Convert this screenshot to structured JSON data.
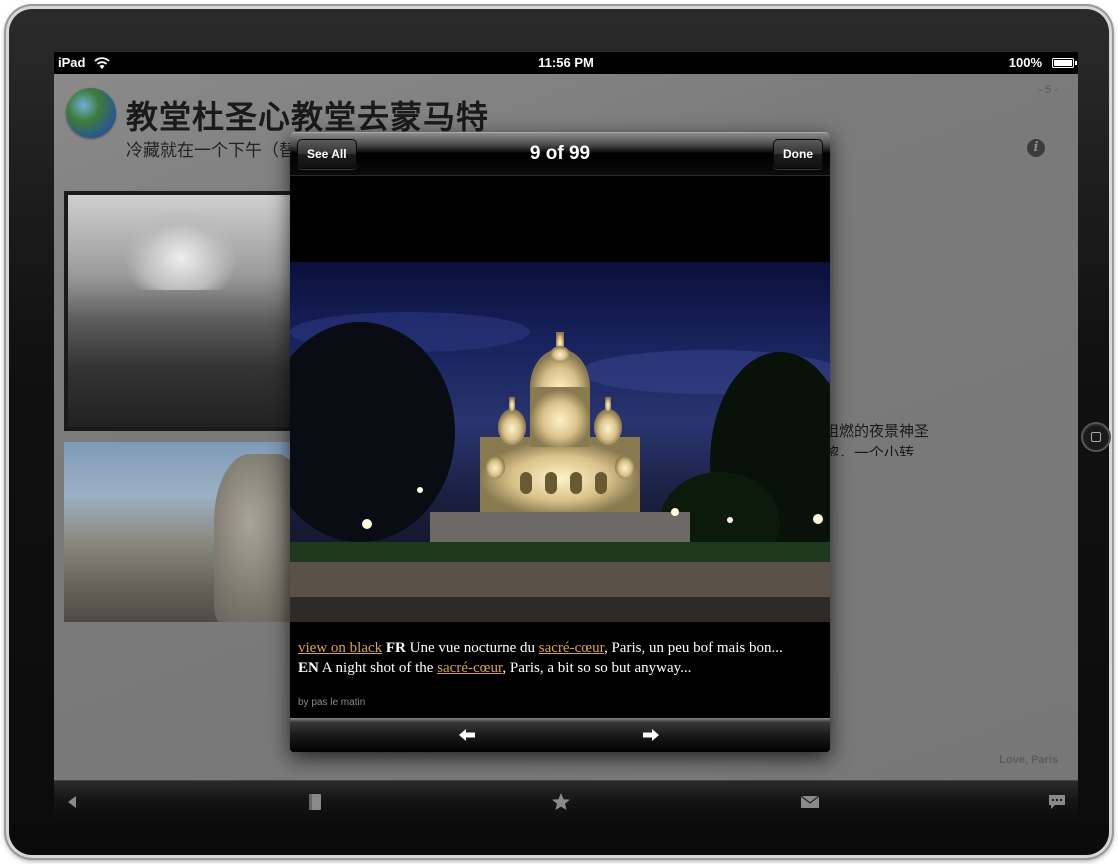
{
  "status_bar": {
    "carrier": "iPad",
    "time": "11:56 PM",
    "battery": "100%"
  },
  "page": {
    "title": "教堂杜圣心教堂去蒙马特",
    "subtitle": "冷藏就在一个下午（替",
    "page_number": "- 5 -",
    "side_text_line1": "阻燃的夜景神圣",
    "side_text_line2": "黎，一个小转",
    "signature": "Love, Paris"
  },
  "gallery": {
    "counter": "9 of 99",
    "see_all_label": "See All",
    "done_label": "Done",
    "caption": {
      "view_on_black": "view on black",
      "fr_tag": "FR",
      "fr_text_1": " Une vue nocturne du ",
      "fr_link": "sacré-cœur",
      "fr_text_2": ", Paris, un peu bof mais bon...",
      "en_tag": "EN",
      "en_text_1": " A night shot of the ",
      "en_link": "sacré-cœur",
      "en_text_2": ", Paris, a bit so so but anyway..."
    },
    "author": "by pas le matin",
    "prev_icon": "left-arrow-icon",
    "next_icon": "right-arrow-icon"
  },
  "toolbar": {
    "icons": [
      "back-triangle-icon",
      "book-icon",
      "star-icon",
      "mail-icon",
      "speech-bubble-icon"
    ]
  },
  "colors": {
    "link": "#d9a441",
    "dim_page": "#7d7d7d"
  }
}
